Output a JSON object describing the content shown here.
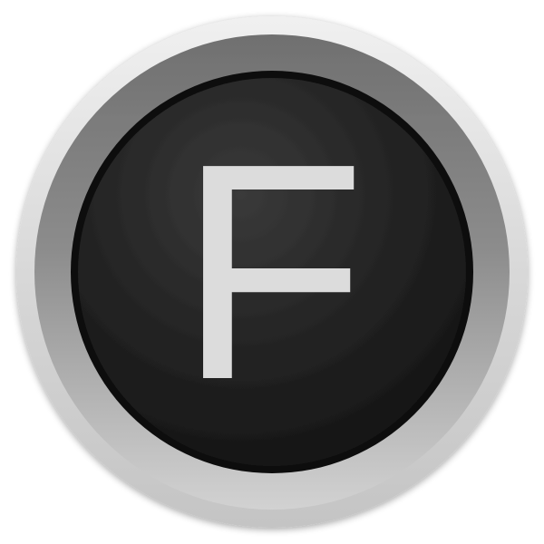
{
  "icon": {
    "name": "app-icon",
    "glyph": "F",
    "glyph_color": "#dcdcdc",
    "face_color": "#1c1c1c",
    "ring_light": "#e9e9e9",
    "ring_dark": "#6f6f6f"
  }
}
